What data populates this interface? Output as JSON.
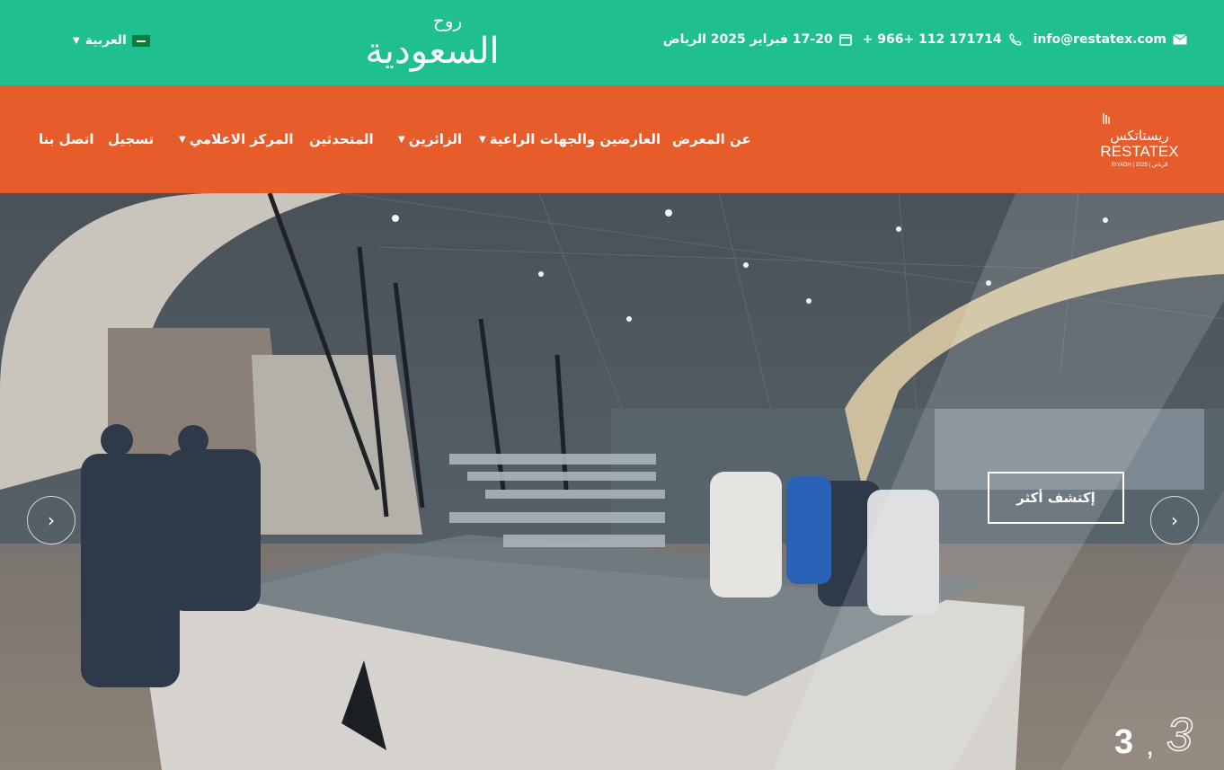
{
  "topbar": {
    "language": "العربية",
    "logo_text_small": "روح",
    "logo_text_main": "السعودية",
    "email": "info@restatex.com",
    "phone": "+ 966+ 112 171714",
    "dates": "17-20 فبراير 2025 الرياض"
  },
  "nav": {
    "logo_arabic": "ريستاتكس",
    "logo_latin": "RESTATEX",
    "logo_sub": "RIYADH | 2025 | الرياض",
    "items": [
      {
        "label": "عن المعرض",
        "has_dropdown": false
      },
      {
        "label": "العارضين والجهات الراعية",
        "has_dropdown": true
      },
      {
        "label": "الزائرين",
        "has_dropdown": true
      },
      {
        "label": "المتحدثين",
        "has_dropdown": false
      },
      {
        "label": "المركز الاعلامي",
        "has_dropdown": true
      },
      {
        "label": "تسجيل",
        "has_dropdown": false
      },
      {
        "label": "اتصل بنا",
        "has_dropdown": false
      }
    ]
  },
  "hero": {
    "cta_label": "إكتشف أكثر",
    "slide_current": "3",
    "slide_separator": ",",
    "slide_total": "3"
  },
  "colors": {
    "topbar": "#1fbf8f",
    "navbar": "#e65c2b"
  }
}
